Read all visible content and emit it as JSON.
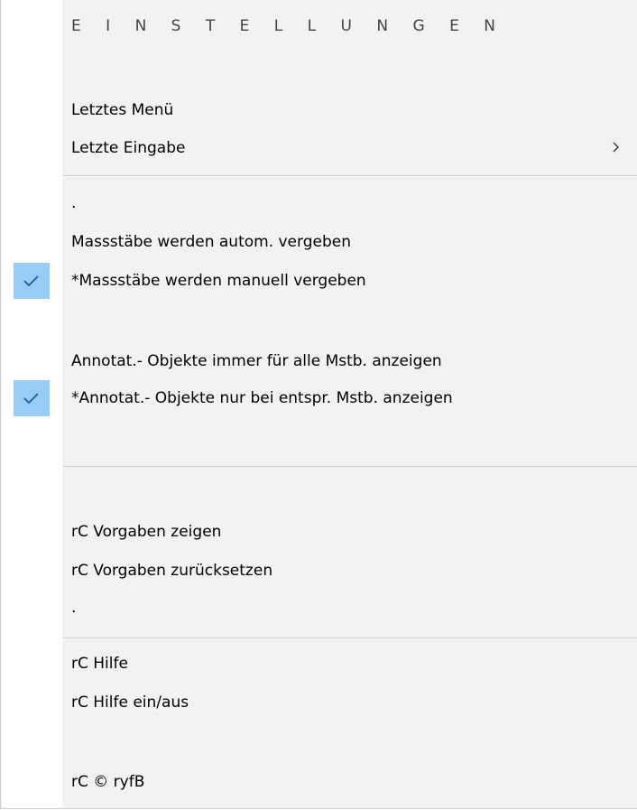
{
  "menu": {
    "heading": "E I N S T E L L U N G E N",
    "items": [
      {
        "label": "Letztes Menü",
        "checked": false
      },
      {
        "label": "Letzte Eingabe",
        "checked": false,
        "submenu": true
      },
      {
        "label": ".",
        "checked": false
      },
      {
        "label": "Massstäbe werden autom. vergeben",
        "checked": false
      },
      {
        "label": "*Massstäbe werden manuell vergeben",
        "checked": true
      },
      {
        "label": "Annotat.- Objekte immer für alle Mstb. anzeigen",
        "checked": false
      },
      {
        "label": "*Annotat.- Objekte nur bei entspr. Mstb. anzeigen",
        "checked": true
      },
      {
        "label": "rC Vorgaben zeigen",
        "checked": false
      },
      {
        "label": "rC Vorgaben zurücksetzen",
        "checked": false
      },
      {
        "label": ".",
        "checked": false
      },
      {
        "label": "rC Hilfe",
        "checked": false
      },
      {
        "label": "rC Hilfe ein/aus",
        "checked": false
      },
      {
        "label": "rC © ryfB",
        "checked": false
      }
    ],
    "colors": {
      "background": "#f2f2f2",
      "gutter": "#ffffff",
      "check_highlight": "#99ccf5",
      "check_mark": "#1a5f9e",
      "separator": "#cdcdcd"
    },
    "icons": {
      "check": "checkmark-icon",
      "submenu": "chevron-right-icon"
    }
  }
}
